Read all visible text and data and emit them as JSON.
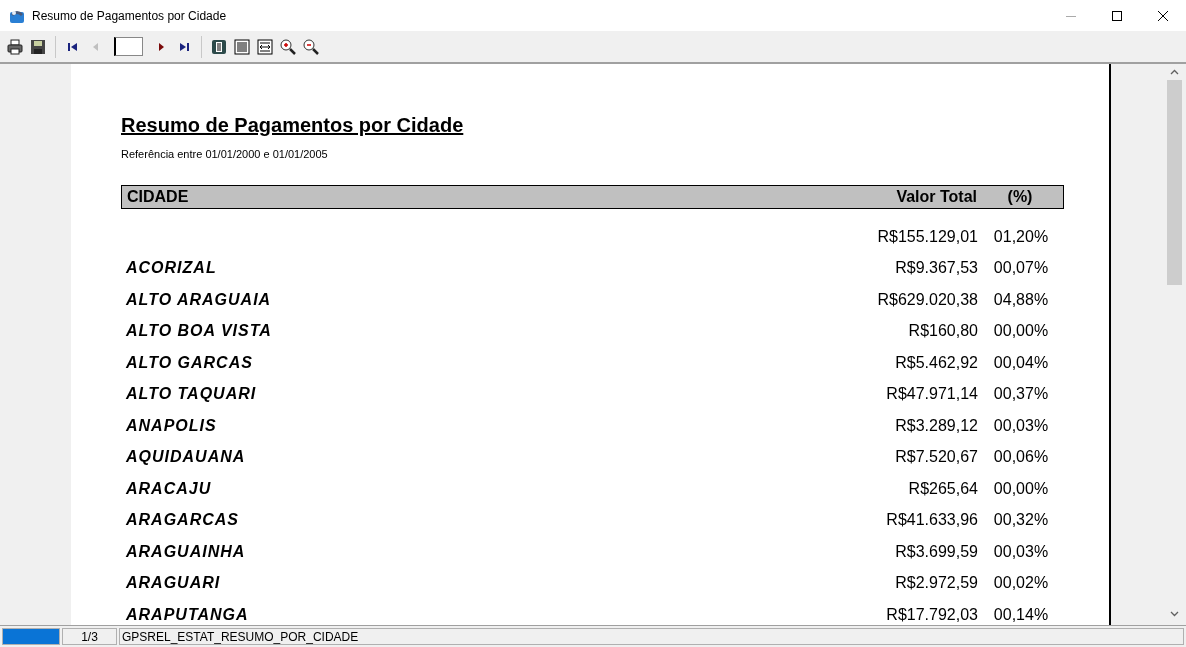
{
  "window": {
    "title": "Resumo de Pagamentos por Cidade"
  },
  "toolbar": {
    "items": [
      {
        "kind": "print"
      },
      {
        "kind": "save"
      },
      {
        "kind": "separator"
      },
      {
        "kind": "first",
        "disabled": false
      },
      {
        "kind": "prev",
        "disabled": true
      },
      {
        "kind": "page-field"
      },
      {
        "kind": "next",
        "disabled": false
      },
      {
        "kind": "last",
        "disabled": false
      },
      {
        "kind": "separator"
      },
      {
        "kind": "page-width"
      },
      {
        "kind": "whole-page"
      },
      {
        "kind": "fit"
      },
      {
        "kind": "zoom-in"
      },
      {
        "kind": "zoom-out"
      }
    ]
  },
  "report": {
    "title": "Resumo de Pagamentos por Cidade",
    "subtitle": "Referência entre 01/01/2000 e 01/01/2005",
    "columns": [
      "CIDADE",
      "Valor Total",
      "(%)"
    ],
    "rows": [
      {
        "city": "",
        "value": "R$155.129,01",
        "percent": "01,20%"
      },
      {
        "city": "ACORIZAL",
        "value": "R$9.367,53",
        "percent": "00,07%"
      },
      {
        "city": "ALTO ARAGUAIA",
        "value": "R$629.020,38",
        "percent": "04,88%"
      },
      {
        "city": "ALTO BOA VISTA",
        "value": "R$160,80",
        "percent": "00,00%"
      },
      {
        "city": "ALTO GARCAS",
        "value": "R$5.462,92",
        "percent": "00,04%"
      },
      {
        "city": "ALTO TAQUARI",
        "value": "R$47.971,14",
        "percent": "00,37%"
      },
      {
        "city": "ANAPOLIS",
        "value": "R$3.289,12",
        "percent": "00,03%"
      },
      {
        "city": "AQUIDAUANA",
        "value": "R$7.520,67",
        "percent": "00,06%"
      },
      {
        "city": "ARACAJU",
        "value": "R$265,64",
        "percent": "00,00%"
      },
      {
        "city": "ARAGARCAS",
        "value": "R$41.633,96",
        "percent": "00,32%"
      },
      {
        "city": "ARAGUAINHA",
        "value": "R$3.699,59",
        "percent": "00,03%"
      },
      {
        "city": "ARAGUARI",
        "value": "R$2.972,59",
        "percent": "00,02%"
      },
      {
        "city": "ARAPUTANGA",
        "value": "R$17.792,03",
        "percent": "00,14%"
      }
    ]
  },
  "status_bar": {
    "progress": {
      "level": 1
    },
    "page": "1/3",
    "report_name": "GPSREL_ESTAT_RESUMO_POR_CIDADE"
  }
}
